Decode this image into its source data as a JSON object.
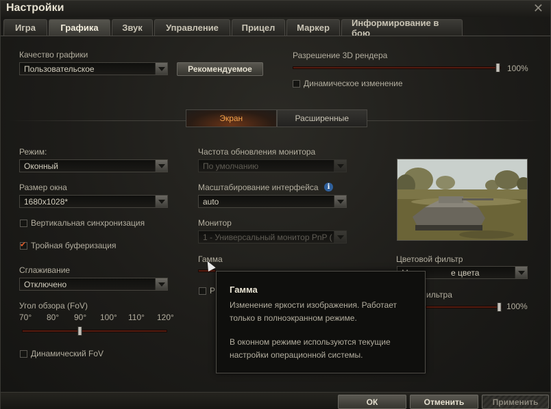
{
  "window": {
    "title": "Настройки",
    "close": "✕"
  },
  "tabs": [
    "Игра",
    "Графика",
    "Звук",
    "Управление",
    "Прицел",
    "Маркер",
    "Информирование в бою"
  ],
  "quality": {
    "label": "Качество графики",
    "value": "Пользовательское",
    "recommended_btn": "Рекомендуемое"
  },
  "render": {
    "label": "Разрешение 3D рендера",
    "value_text": "100%",
    "level": 1.0,
    "dynamic_label": "Динамическое изменение"
  },
  "subtabs": [
    "Экран",
    "Расширенные"
  ],
  "left": {
    "mode_label": "Режим:",
    "mode_value": "Оконный",
    "size_label": "Размер окна",
    "size_value": "1680x1028*",
    "vsync_label": "Вертикальная синхронизация",
    "triple_label": "Тройная буферизация",
    "aa_label": "Сглаживание",
    "aa_value": "Отключено",
    "fov_label": "Угол обзора (FoV)",
    "fov_ticks": [
      "70°",
      "80°",
      "90°",
      "100°",
      "110°",
      "120°"
    ],
    "fov_value": 90,
    "dynfov_label": "Динамический FoV"
  },
  "middle": {
    "refresh_label": "Частота обновления монитора",
    "refresh_value": "По умолчанию",
    "scale_label": "Масштабирование интерфейса",
    "scale_value": "auto",
    "info_icon": "i",
    "monitor_label": "Монитор",
    "monitor_value": "1 - Универсальный монитор PnP (",
    "gamma_label": "Гамма",
    "partial_checkbox_text": "Р"
  },
  "right": {
    "filter_label": "Цветовой фильтр",
    "filter_value_partial": "М",
    "filter_value_tail": "е цвета",
    "intensity_label_partial": "ильтра",
    "intensity_value_text": "100%",
    "intensity_level": 1.0
  },
  "tooltip": {
    "title": "Гамма",
    "line1": "Изменение яркости изображения. Работает",
    "line2": "только в полноэкранном режиме.",
    "line3": "В оконном режиме используются текущие",
    "line4": "настройки операционной системы."
  },
  "footer": {
    "ok": "ОК",
    "cancel": "Отменить",
    "apply": "Применить"
  }
}
